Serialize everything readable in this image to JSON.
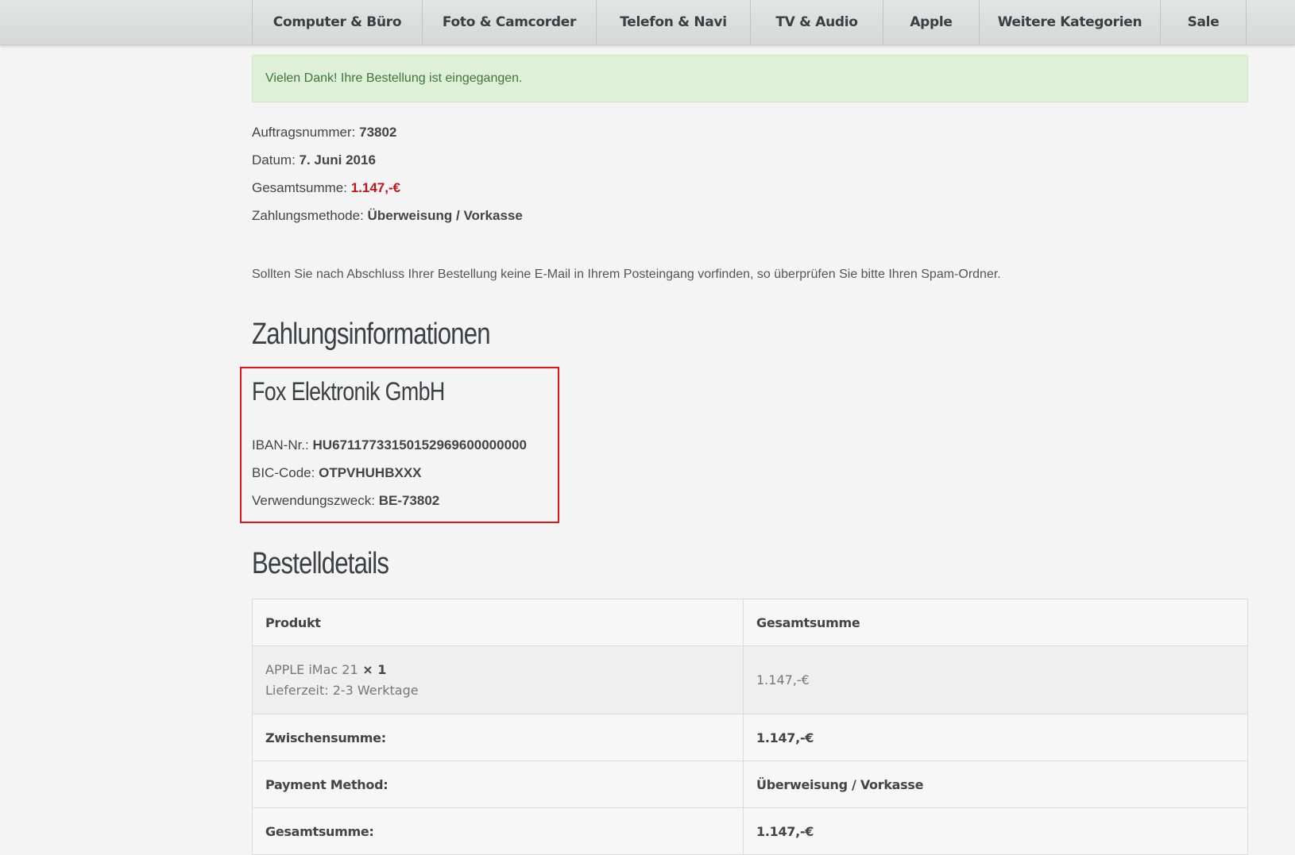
{
  "nav": {
    "items": [
      {
        "label": "Computer & Büro"
      },
      {
        "label": "Foto & Camcorder"
      },
      {
        "label": "Telefon & Navi"
      },
      {
        "label": "TV & Audio"
      },
      {
        "label": "Apple"
      },
      {
        "label": "Weitere Kategorien"
      },
      {
        "label": "Sale"
      }
    ]
  },
  "alert": {
    "message": "Vielen Dank! Ihre Bestellung ist eingegangen."
  },
  "order_meta": {
    "order_number_label": "Auftragsnummer: ",
    "order_number": "73802",
    "date_label": "Datum: ",
    "date": "7. Juni 2016",
    "total_label": "Gesamtsumme: ",
    "total": "1.147,-€",
    "payment_label": "Zahlungsmethode: ",
    "payment": "Überweisung / Vorkasse"
  },
  "notice": "Sollten Sie nach Abschluss Ihrer Bestellung keine E-Mail in Ihrem Posteingang vorfinden, so überprüfen Sie bitte Ihren Spam-Ordner.",
  "payment_info": {
    "heading": "Zahlungsinformationen",
    "company": "Fox Elektronik GmbH",
    "iban_label": "IBAN-Nr.: ",
    "iban": "HU67117733150152969600000000",
    "bic_label": "BIC-Code: ",
    "bic": "OTPVHUHBXXX",
    "reference_label": "Verwendungszweck: ",
    "reference": "BE-73802",
    "highlight_color": "#e0161c"
  },
  "order_details": {
    "heading": "Bestelldetails",
    "columns": [
      "Produkt",
      "Gesamtsumme"
    ],
    "item": {
      "name": "APPLE iMac 21",
      "qty": " × 1",
      "delivery": "Lieferzeit: 2-3 Werktage",
      "total": "1.147,-€"
    },
    "rows": [
      {
        "label": "Zwischensumme:",
        "value": "1.147,-€"
      },
      {
        "label": "Payment Method:",
        "value": "Überweisung / Vorkasse"
      },
      {
        "label": "Gesamtsumme:",
        "value": "1.147,-€"
      }
    ]
  },
  "colors": {
    "alert_bg": "#dff0d8",
    "alert_text": "#3c763d",
    "price": "#c3131b"
  }
}
